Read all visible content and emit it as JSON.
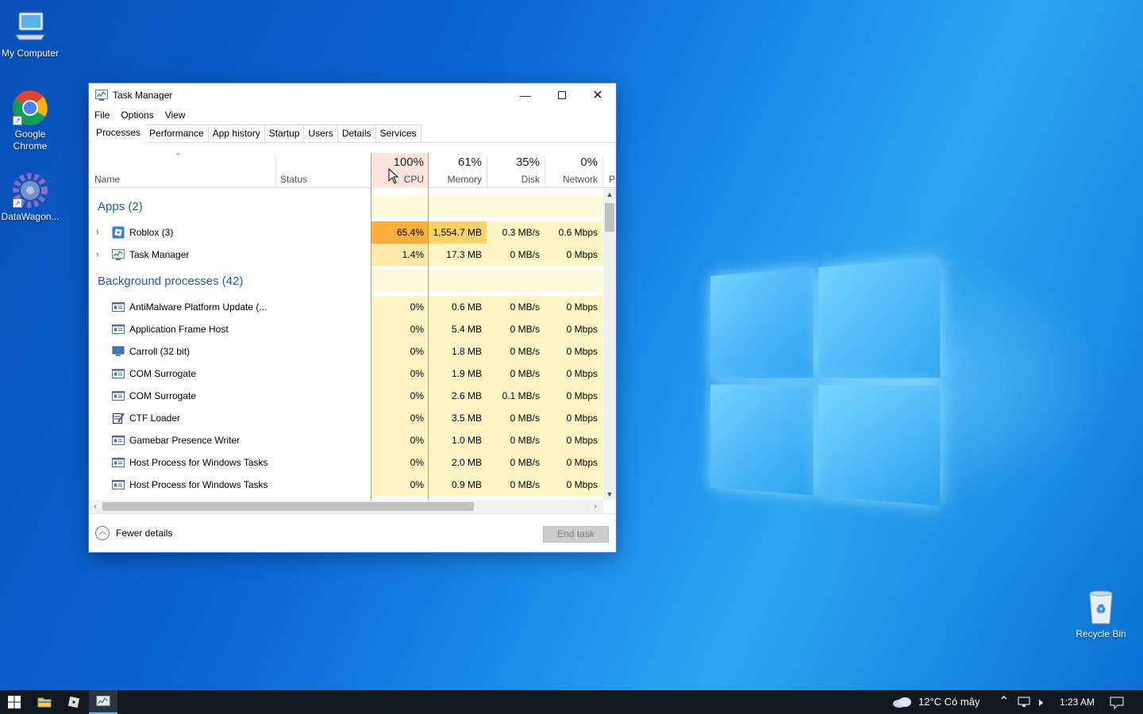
{
  "desktop": {
    "icons": [
      {
        "label": "My Computer",
        "icon": "computer-icon"
      },
      {
        "label": "Google Chrome",
        "icon": "chrome-icon"
      },
      {
        "label": "DataWagon...",
        "icon": "gear-icon"
      },
      {
        "label": "Recycle Bin",
        "icon": "recycle-bin-icon"
      }
    ]
  },
  "window": {
    "title": "Task Manager",
    "menu": [
      "File",
      "Options",
      "View"
    ],
    "tabs": [
      "Processes",
      "Performance",
      "App history",
      "Startup",
      "Users",
      "Details",
      "Services"
    ],
    "active_tab": "Processes",
    "columns": {
      "name": "Name",
      "status": "Status",
      "cpu": {
        "pct": "100%",
        "label": "CPU"
      },
      "memory": {
        "pct": "61%",
        "label": "Memory"
      },
      "disk": {
        "pct": "35%",
        "label": "Disk"
      },
      "network": {
        "pct": "0%",
        "label": "Network"
      },
      "next_partial": "P"
    },
    "groups": {
      "apps": "Apps (2)",
      "background": "Background processes (42)"
    },
    "apps": [
      {
        "name": "Roblox (3)",
        "cpu": "65.4%",
        "memory": "1,554.7 MB",
        "disk": "0.3 MB/s",
        "network": "0.6 Mbps"
      },
      {
        "name": "Task Manager",
        "cpu": "1.4%",
        "memory": "17.3 MB",
        "disk": "0 MB/s",
        "network": "0 Mbps"
      }
    ],
    "background": [
      {
        "name": "AntiMalware Platform Update (...",
        "cpu": "0%",
        "memory": "0.6 MB",
        "disk": "0 MB/s",
        "network": "0 Mbps"
      },
      {
        "name": "Application Frame Host",
        "cpu": "0%",
        "memory": "5.4 MB",
        "disk": "0 MB/s",
        "network": "0 Mbps"
      },
      {
        "name": "Carroll (32 bit)",
        "cpu": "0%",
        "memory": "1.8 MB",
        "disk": "0 MB/s",
        "network": "0 Mbps"
      },
      {
        "name": "COM Surrogate",
        "cpu": "0%",
        "memory": "1.9 MB",
        "disk": "0 MB/s",
        "network": "0 Mbps"
      },
      {
        "name": "COM Surrogate",
        "cpu": "0%",
        "memory": "2.6 MB",
        "disk": "0.1 MB/s",
        "network": "0 Mbps"
      },
      {
        "name": "CTF Loader",
        "cpu": "0%",
        "memory": "3.5 MB",
        "disk": "0 MB/s",
        "network": "0 Mbps"
      },
      {
        "name": "Gamebar Presence Writer",
        "cpu": "0%",
        "memory": "1.0 MB",
        "disk": "0 MB/s",
        "network": "0 Mbps"
      },
      {
        "name": "Host Process for Windows Tasks",
        "cpu": "0%",
        "memory": "2.0 MB",
        "disk": "0 MB/s",
        "network": "0 Mbps"
      },
      {
        "name": "Host Process for Windows Tasks",
        "cpu": "0%",
        "memory": "0.9 MB",
        "disk": "0 MB/s",
        "network": "0 Mbps"
      }
    ],
    "footer": {
      "fewer_details": "Fewer details",
      "end_task": "End task"
    }
  },
  "taskbar": {
    "weather": "12°C  Có mây",
    "time": "1:23 AM"
  },
  "colors": {
    "heat_hot": "#ffad3b",
    "heat_warm": "#ffd16b",
    "heat_light": "#fff4c4",
    "group_label": "#1f5ba8"
  }
}
